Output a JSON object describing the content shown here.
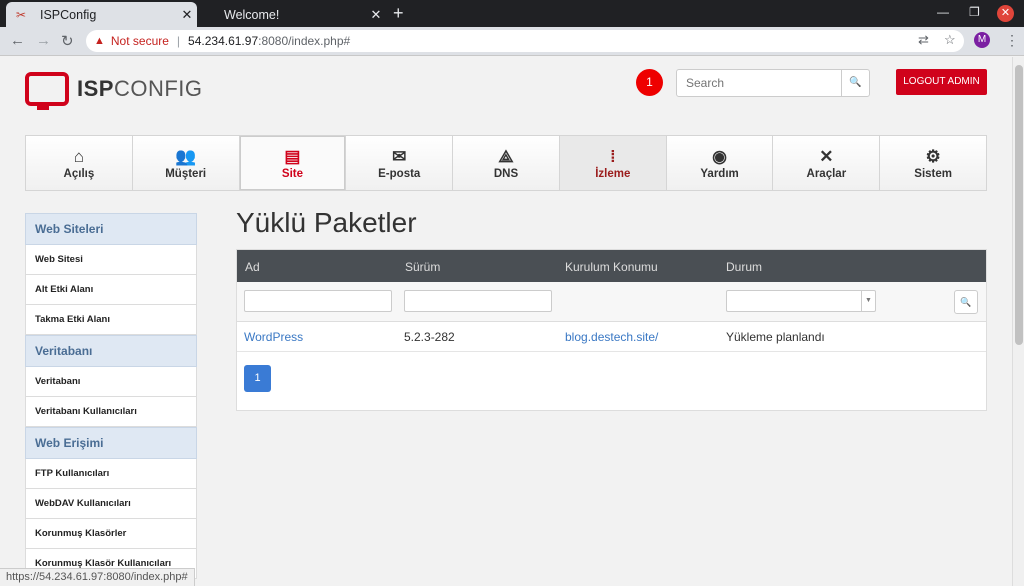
{
  "browser": {
    "tabs": [
      {
        "title": "ISPConfig",
        "active": true
      },
      {
        "title": "Welcome!",
        "active": false
      }
    ],
    "address": {
      "warning": "Not secure",
      "host": "54.234.61.97",
      "path": ":8080/index.php#"
    },
    "profile_initial": "M",
    "status_url": "https://54.234.61.97:8080/index.php#"
  },
  "header": {
    "logo_bold": "ISP",
    "logo_light": "CONFIG",
    "notification_count": "1",
    "search_placeholder": "Search",
    "logout_label": "LOGOUT ADMIN"
  },
  "nav": [
    {
      "label": "Açılış",
      "icon": "home-icon",
      "glyph": "⌂"
    },
    {
      "label": "Müşteri",
      "icon": "users-icon",
      "glyph": "👥"
    },
    {
      "label": "Site",
      "icon": "site-icon",
      "glyph": "▤"
    },
    {
      "label": "E-posta",
      "icon": "email-icon",
      "glyph": "✉"
    },
    {
      "label": "DNS",
      "icon": "dns-icon",
      "glyph": "⟁"
    },
    {
      "label": "İzleme",
      "icon": "traffic-light-icon",
      "glyph": "⁞"
    },
    {
      "label": "Yardım",
      "icon": "lifebuoy-icon",
      "glyph": "◉"
    },
    {
      "label": "Araçlar",
      "icon": "tools-icon",
      "glyph": "✕"
    },
    {
      "label": "Sistem",
      "icon": "gear-icon",
      "glyph": "⚙"
    }
  ],
  "sidebar": {
    "groups": [
      {
        "title": "Web Siteleri",
        "items": [
          "Web Sitesi",
          "Alt Etki Alanı",
          "Takma Etki Alanı"
        ]
      },
      {
        "title": "Veritabanı",
        "items": [
          "Veritabanı",
          "Veritabanı Kullanıcıları"
        ]
      },
      {
        "title": "Web Erişimi",
        "items": [
          "FTP Kullanıcıları",
          "WebDAV Kullanıcıları",
          "Korunmuş Klasörler",
          "Korunmuş Klasör Kullanıcıları"
        ]
      }
    ]
  },
  "main": {
    "title": "Yüklü Paketler",
    "columns": [
      "Ad",
      "Sürüm",
      "Kurulum Konumu",
      "Durum"
    ],
    "rows": [
      {
        "name": "WordPress",
        "version": "5.2.3-282",
        "location": "blog.destech.site/",
        "status": "Yükleme planlandı"
      }
    ],
    "page": "1"
  },
  "colors": {
    "brand_red": "#d0021b",
    "link_blue": "#3a78c4",
    "table_header": "#4a4f54"
  }
}
